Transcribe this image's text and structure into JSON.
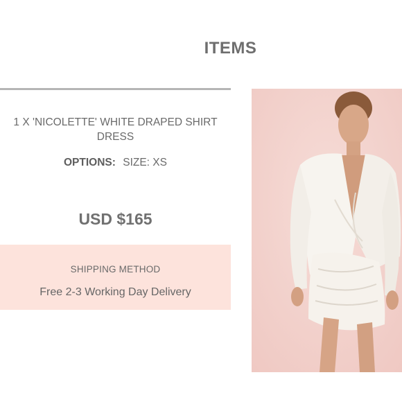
{
  "header": {
    "title": "ITEMS"
  },
  "item": {
    "name": "1 X 'NICOLETTE' WHITE DRAPED SHIRT DRESS",
    "options_label": "OPTIONS:",
    "options_value": "SIZE: XS",
    "price": "USD $165",
    "image_alt": "Model wearing white draped shirt dress"
  },
  "shipping": {
    "title": "SHIPPING METHOD",
    "value": "Free 2-3 Working Day Delivery"
  },
  "colors": {
    "shipping_background": "#fde3dc",
    "photo_background": "#f3d2cd",
    "divider": "#b5b5b5",
    "text": "#6a6a6a"
  },
  "icons": {
    "logo": "brand-script-logo"
  }
}
